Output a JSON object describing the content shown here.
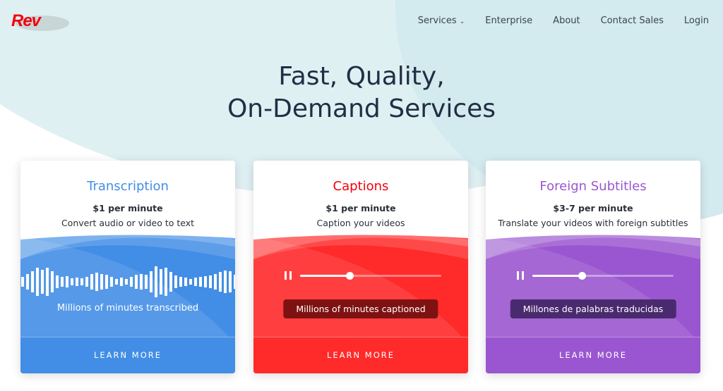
{
  "logo": {
    "text": "Rev"
  },
  "nav": {
    "items": [
      "Services",
      "Enterprise",
      "About",
      "Contact Sales",
      "Login"
    ],
    "services_chevron": "chevron-down-icon"
  },
  "hero": {
    "line1": "Fast, Quality,",
    "line2": "On-Demand Services"
  },
  "cards": [
    {
      "title": "Transcription",
      "price": "$1 per minute",
      "desc": "Convert audio or video to text",
      "caption": "Millions of minutes transcribed",
      "cta": "LEARN MORE",
      "color": "#428ee6",
      "title_color": "#428ee6"
    },
    {
      "title": "Captions",
      "price": "$1 per minute",
      "desc": "Caption your videos",
      "caption": "Millions of minutes captioned",
      "cta": "LEARN MORE",
      "color": "#ff2a2a",
      "title_color": "#f5000c",
      "pill_color": "#7e1212",
      "progress": 0.35
    },
    {
      "title": "Foreign Subtitles",
      "price": "$3-7 per minute",
      "desc": "Translate your videos with foreign subtitles",
      "caption": "Millones de palabras traducidas",
      "cta": "LEARN MORE",
      "color": "#9a56d0",
      "title_color": "#9a56d0",
      "pill_color": "#4a2a6e",
      "progress": 0.35
    }
  ]
}
